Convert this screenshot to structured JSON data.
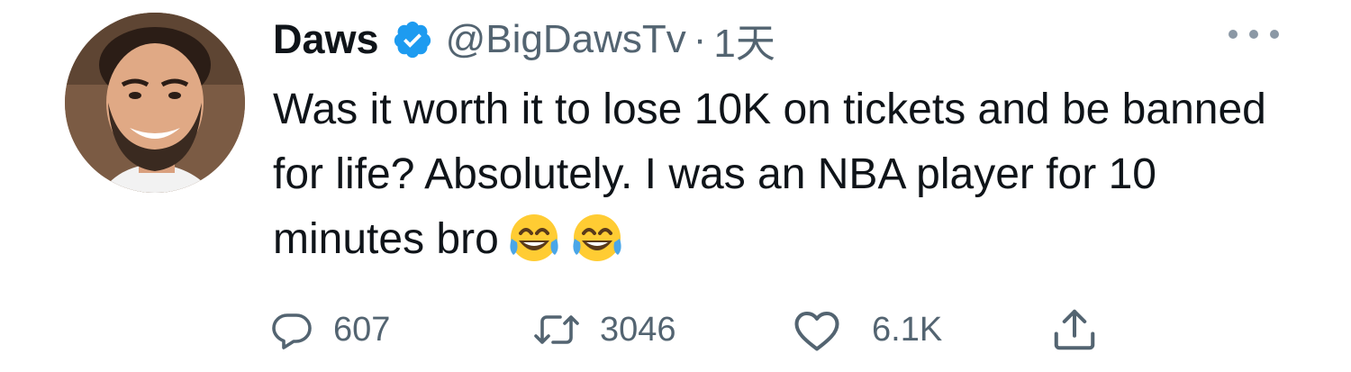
{
  "tweet": {
    "author_name": "Daws",
    "handle": "@BigDawsTv",
    "separator": "·",
    "time": "1天",
    "text": "Was it worth it to lose 10K on tickets and be banned for life? Absolutely. I was an NBA player for 10 minutes bro",
    "emojis": [
      "face-with-tears-of-joy",
      "face-with-tears-of-joy"
    ]
  },
  "actions": {
    "reply_count": "607",
    "retweet_count": "3046",
    "like_count": "6.1K"
  },
  "colors": {
    "verified": "#1d9bf0",
    "secondary_text": "#536471",
    "primary_text": "#0f1419"
  },
  "icons": {
    "reply": "speech-bubble-icon",
    "retweet": "retweet-arrows-icon",
    "like": "heart-icon",
    "share": "share-upload-icon",
    "more": "more-dots-icon",
    "verified": "verified-badge-icon"
  }
}
